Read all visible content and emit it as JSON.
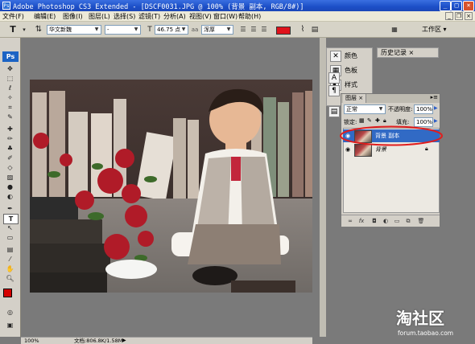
{
  "window": {
    "title": "Adobe Photoshop CS3 Extended - [DSCF0031.JPG @ 100% (背景 副本, RGB/8#)]",
    "controls": [
      "_",
      "□",
      "×"
    ]
  },
  "menubar": {
    "items": [
      {
        "label": "文件(F)"
      },
      {
        "label": "编辑(E)"
      },
      {
        "label": "图像(I)"
      },
      {
        "label": "图层(L)"
      },
      {
        "label": "选择(S)"
      },
      {
        "label": "滤镜(T)"
      },
      {
        "label": "分析(A)"
      },
      {
        "label": "视图(V)"
      },
      {
        "label": "窗口(W)"
      },
      {
        "label": "帮助(H)"
      }
    ]
  },
  "options": {
    "font_family": "华文新魏",
    "font_style": "-",
    "font_size": "46.75 点",
    "antialias": "浑厚",
    "text_color": "#e0121b",
    "workspace_label": "工作区 ▾"
  },
  "toolbox": {
    "logo": "Ps",
    "fg_color": "#d40000",
    "bg_color": "#ffffff"
  },
  "status": {
    "zoom": "100%",
    "doc_info": "文档:806.8K/1.58M"
  },
  "panels": {
    "collapsed": [
      {
        "label": "颜色"
      },
      {
        "label": "色板"
      },
      {
        "label": "样式"
      }
    ],
    "history_tab": "历史记录 ×",
    "layers": {
      "tab_label": "图层 ×",
      "blend_mode": "正常",
      "opacity_label": "不透明度:",
      "opacity_value": "100%",
      "lock_label": "锁定:",
      "fill_label": "填充:",
      "fill_value": "100%",
      "items": [
        {
          "name": "背景 副本",
          "selected": true
        },
        {
          "name": "背景",
          "selected": false,
          "locked": true
        }
      ]
    }
  },
  "watermark": {
    "brand": "淘社区",
    "url": "forum.taobao.com"
  }
}
